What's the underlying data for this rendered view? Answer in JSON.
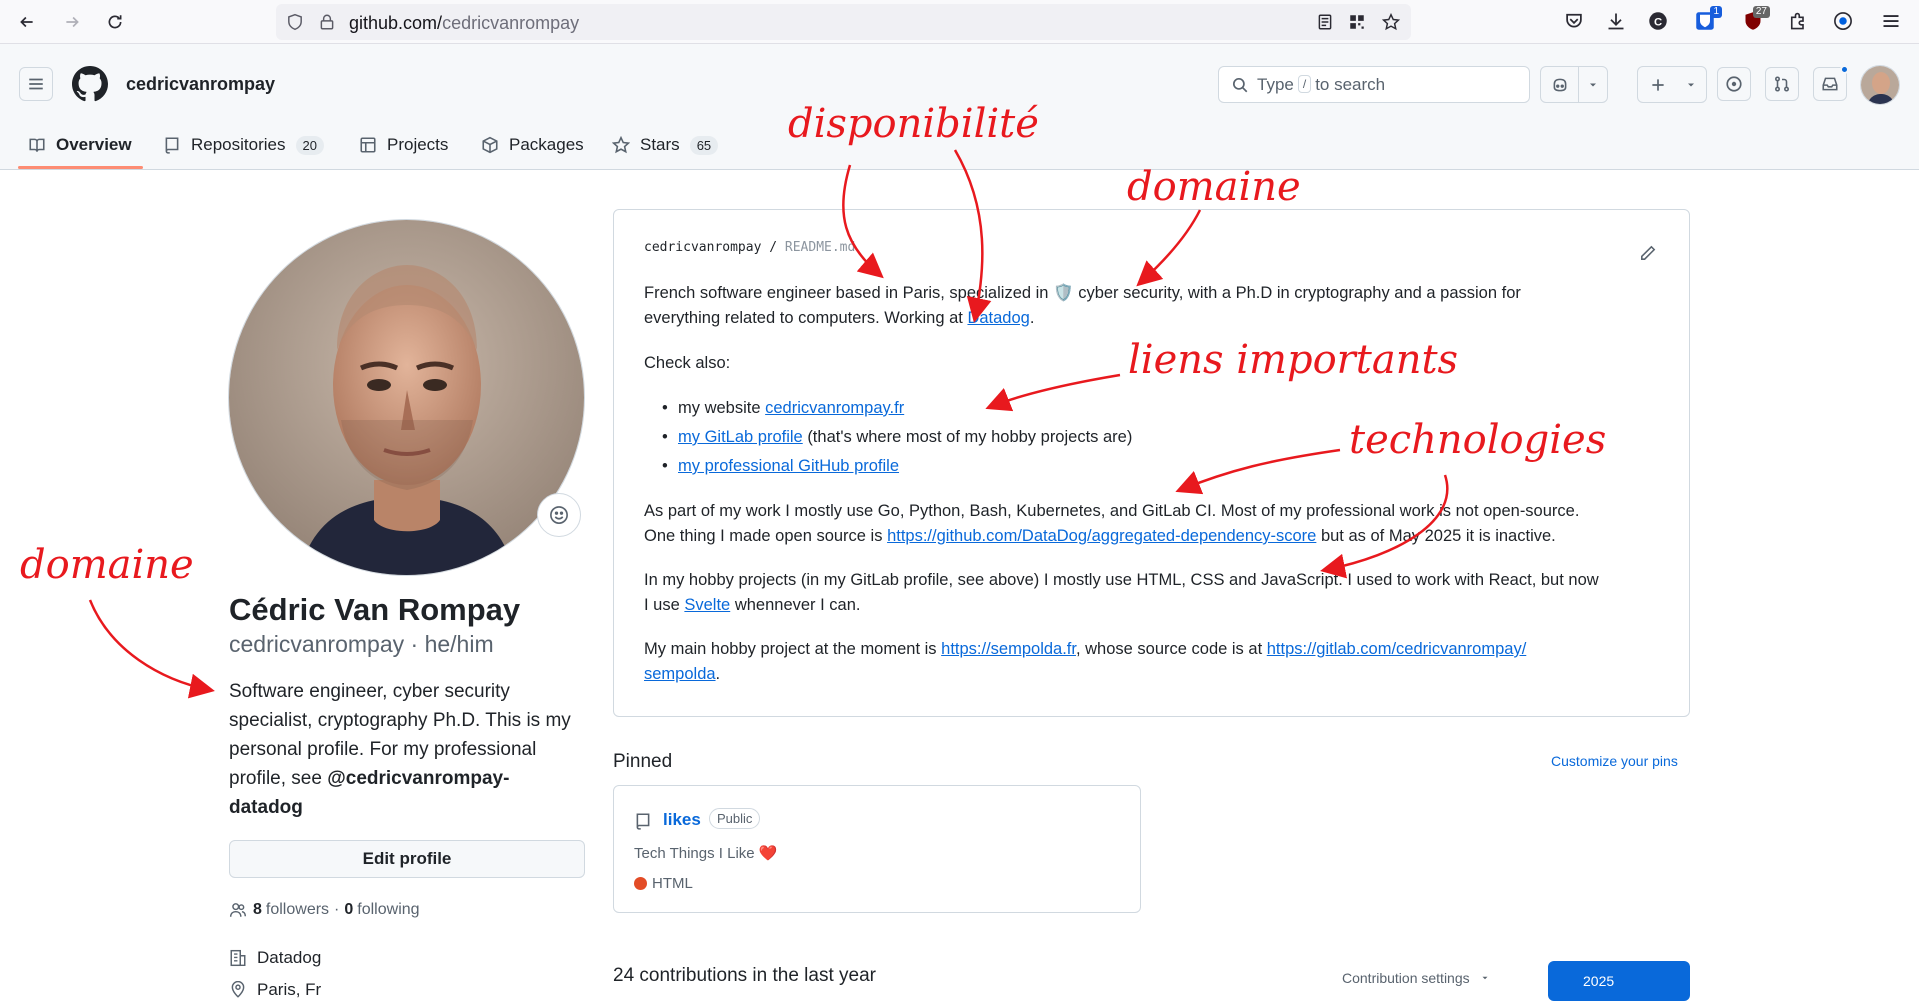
{
  "browser": {
    "url_host": "github.com/",
    "url_path": "cedricvanrompay",
    "bitwarden_badge": "1",
    "ublock_badge": "27"
  },
  "header": {
    "username": "cedricvanrompay",
    "search_prefix": "Type",
    "search_key": "/",
    "search_suffix": "to search"
  },
  "tabs": [
    {
      "label": "Overview"
    },
    {
      "label": "Repositories",
      "count": "20"
    },
    {
      "label": "Projects"
    },
    {
      "label": "Packages"
    },
    {
      "label": "Stars",
      "count": "65"
    }
  ],
  "profile": {
    "name": "Cédric Van Rompay",
    "handle_line": "cedricvanrompay · he/him",
    "bio_text": "Software engineer, cyber security specialist, cryptography Ph.D. This is my personal profile. For my professional profile, see",
    "bio_link": "@cedricvanrompay-datadog",
    "edit_button": "Edit profile",
    "followers_count": "8",
    "followers_label": "followers",
    "separator": "·",
    "following_count": "0",
    "following_label": "following",
    "company": "Datadog",
    "location_partial": "Paris, Fr"
  },
  "readme": {
    "owner": "cedricvanrompay",
    "file": "README.md",
    "p1_a": "French software engineer based in Paris, specialized in",
    "p1_emoji": "🛡️",
    "p1_b": "cyber security, with a Ph.D in cryptography and a passion for",
    "p1_c": "everything related to computers. Working at",
    "p1_link": "Datadog",
    "p2": "Check also:",
    "li1_text": "my website",
    "li1_link": "cedricvanrompay.fr",
    "li2_link": "my GitLab profile",
    "li2_text": "(that's where most of my hobby projects are)",
    "li3_link": "my professional GitHub profile",
    "p3_a": "As part of my work I mostly use Go, Python, Bash, Kubernetes, and GitLab CI. Most of my professional work is not open-source.",
    "p3_b": "One thing I made open source is",
    "p3_link": "https://github.com/DataDog/aggregated-dependency-score",
    "p3_c": "but as of May 2025 it is inactive.",
    "p4_a": "In my hobby projects (in my GitLab profile, see above) I mostly use HTML, CSS and JavaScript. I used to work with React, but now",
    "p4_b": "I use",
    "p4_link": "Svelte",
    "p4_c": "whennever I can.",
    "p5_a": "My main hobby project at the moment is",
    "p5_link1": "https://sempolda.fr",
    "p5_b": ", whose source code is at",
    "p5_link2a": "https://gitlab.com/cedricvanrompay/",
    "p5_link2b": "sempolda"
  },
  "pinned": {
    "title": "Pinned",
    "customize": "Customize your pins",
    "repo_name": "likes",
    "visibility": "Public",
    "description": "Tech Things I Like ❤️",
    "language": "HTML",
    "language_color": "#e34c26"
  },
  "contributions": {
    "title": "24 contributions in the last year",
    "settings": "Contribution settings",
    "year": "2025"
  },
  "annotations": {
    "disponibilite": "disponibilité",
    "domaine_top": "domaine",
    "liens": "liens  importants",
    "technologies": "technologies",
    "domaine_left": "domaine",
    "color": "#e8191e"
  }
}
